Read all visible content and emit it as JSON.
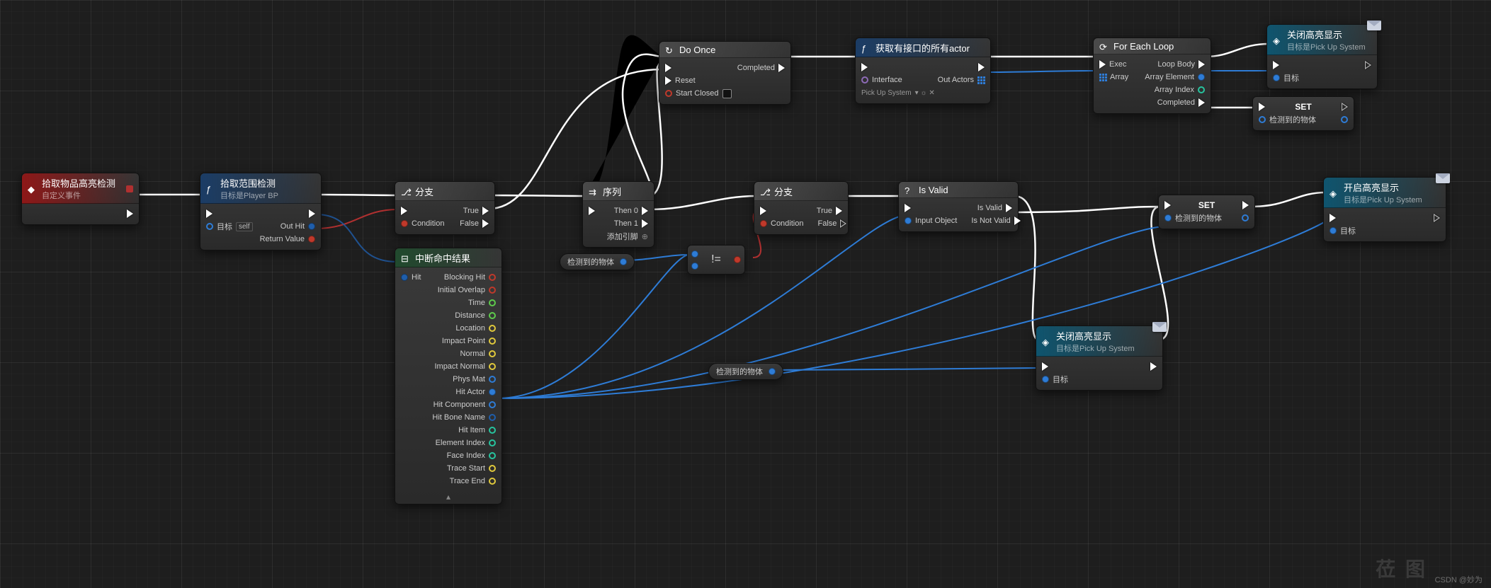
{
  "footer": {
    "credit": "CSDN @妙为",
    "logo": "莅 图"
  },
  "nodes": {
    "customEvent": {
      "title": "拾取物品高亮检测",
      "subtitle": "自定义事件"
    },
    "rangeCheck": {
      "title": "拾取范围检测",
      "subtitle": "目标是Player BP",
      "pin_target": "目标",
      "pin_self": "self",
      "pin_outhit": "Out Hit",
      "pin_return": "Return Value"
    },
    "branch1": {
      "title": "分支",
      "pin_cond": "Condition",
      "pin_true": "True",
      "pin_false": "False"
    },
    "sequence": {
      "title": "序列",
      "pin_then0": "Then 0",
      "pin_then1": "Then 1",
      "pin_add": "添加引脚"
    },
    "doOnce": {
      "title": "Do Once",
      "pin_reset": "Reset",
      "pin_start": "Start Closed",
      "pin_completed": "Completed"
    },
    "getAllActors": {
      "title": "获取有接口的所有actor",
      "pin_interface": "Interface",
      "pin_interface_val": "Pick Up System",
      "pin_outactors": "Out Actors"
    },
    "forEach": {
      "title": "For Each Loop",
      "pin_exec": "Exec",
      "pin_array": "Array",
      "pin_loop": "Loop Body",
      "pin_elem": "Array Element",
      "pin_idx": "Array Index",
      "pin_done": "Completed"
    },
    "closeHLTop": {
      "title": "关闭高亮显示",
      "subtitle": "目标是Pick Up System",
      "pin_target": "目标"
    },
    "closeHLMid": {
      "title": "关闭高亮显示",
      "subtitle": "目标是Pick Up System",
      "pin_target": "目标"
    },
    "branch2": {
      "title": "分支",
      "pin_cond": "Condition",
      "pin_true": "True",
      "pin_false": "False"
    },
    "isValid": {
      "title": "Is Valid",
      "pin_input": "Input Object",
      "pin_valid": "Is Valid",
      "pin_notvalid": "Is Not Valid"
    },
    "set1": {
      "title": "SET",
      "pin_var": "检测到的物体"
    },
    "set2": {
      "title": "SET",
      "pin_var": "检测到的物体"
    },
    "openHL": {
      "title": "开启高亮显示",
      "subtitle": "目标是Pick Up System",
      "pin_target": "目标"
    },
    "breakHit": {
      "title": "中断命中结果",
      "pins": [
        "Hit",
        "Blocking Hit",
        "Initial Overlap",
        "Time",
        "Distance",
        "Location",
        "Impact Point",
        "Normal",
        "Impact Normal",
        "Phys Mat",
        "Hit Actor",
        "Hit Component",
        "Hit Bone Name",
        "Hit Item",
        "Element Index",
        "Face Index",
        "Trace Start",
        "Trace End"
      ]
    },
    "varGet1": {
      "label": "检测到的物体"
    },
    "varGet2": {
      "label": "检测到的物体"
    },
    "neq": {
      "op": "!="
    }
  },
  "wires_note": "Node connection wires are rendered via the SVG layer below. Colors: white=exec, red=bool, blue=object/struct, cyan=index."
}
